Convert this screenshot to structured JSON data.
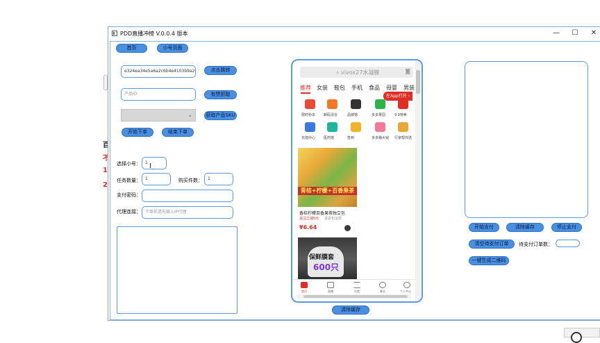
{
  "background": {
    "chars": [
      "百",
      "不",
      "1",
      "2"
    ]
  },
  "window": {
    "title": "PDD直播冲榜 V.0.0.4 版本",
    "minimize": "—",
    "maximize": "☐",
    "close": "✕"
  },
  "nav": {
    "home": "首页",
    "sub_page": "小号页面"
  },
  "left": {
    "hash_value": "e324ea34e5a6a2c6b4e4103b9a2d6",
    "jump_button": "点击跳转",
    "product_id_placeholder": "产品ID",
    "fetch_button": "有赞抓取",
    "sku_button": "获取产品SKU",
    "start_order": "开始下单",
    "end_order": "结束下单",
    "select_account_label": "选择小号：",
    "select_account_value": "1",
    "task_count_label": "任务数量：",
    "task_count_value": "1",
    "buy_count_label": "购买件数：",
    "buy_count_value": "1",
    "pay_password_label": "支付密码：",
    "pay_password_value": "",
    "proxy_label": "代理连接：",
    "proxy_placeholder": "下单前请先输入IP代理"
  },
  "phone": {
    "search_placeholder": "vivox27水凝膜",
    "categories": [
      "推荐",
      "女装",
      "鞋包",
      "手机",
      "食品",
      "母婴",
      "男装"
    ],
    "app_open": "在App打开 ›",
    "icons_row1": [
      {
        "label": "限时秒杀",
        "color": "#e84a3a"
      },
      {
        "label": "断码清仓",
        "color": "#f07a2a"
      },
      {
        "label": "品牌馆",
        "color": "#333333"
      },
      {
        "label": "多多果园",
        "color": "#2db34a"
      },
      {
        "label": "9.9特卖",
        "color": "#e02e24"
      }
    ],
    "icons_row2": [
      {
        "label": "充值中心",
        "color": "#3a7ae0"
      },
      {
        "label": "医药馆",
        "color": "#1fb59a"
      },
      {
        "label": "签到",
        "color": "#f0b429"
      },
      {
        "label": "多多赚大钱",
        "color": "#f07a9a"
      },
      {
        "label": "行家帮你选",
        "color": "#e8a838"
      }
    ],
    "product1": {
      "banner": "青桔+柠檬+百香果茶",
      "title": "香桔柠檬百香果茶独立包",
      "sub": "关注立减5元",
      "sub2": "退货包运费",
      "price": "¥6.64"
    },
    "product2": {
      "line1": "保鲜膜套",
      "line2": "600只"
    },
    "bottom_nav": [
      "首页",
      "直播",
      "分类",
      "聊天",
      "个人中心"
    ]
  },
  "phone_footer": {
    "clear_cache": "清除缓存"
  },
  "right": {
    "start_pay": "开始支付",
    "clear_cache": "清除缓存",
    "stop_pay": "停止支付",
    "clear_pending": "清空待支付订单",
    "pending_label": "待支付订单数：",
    "pending_value": "",
    "gen_qr": "一键生成二维码"
  }
}
